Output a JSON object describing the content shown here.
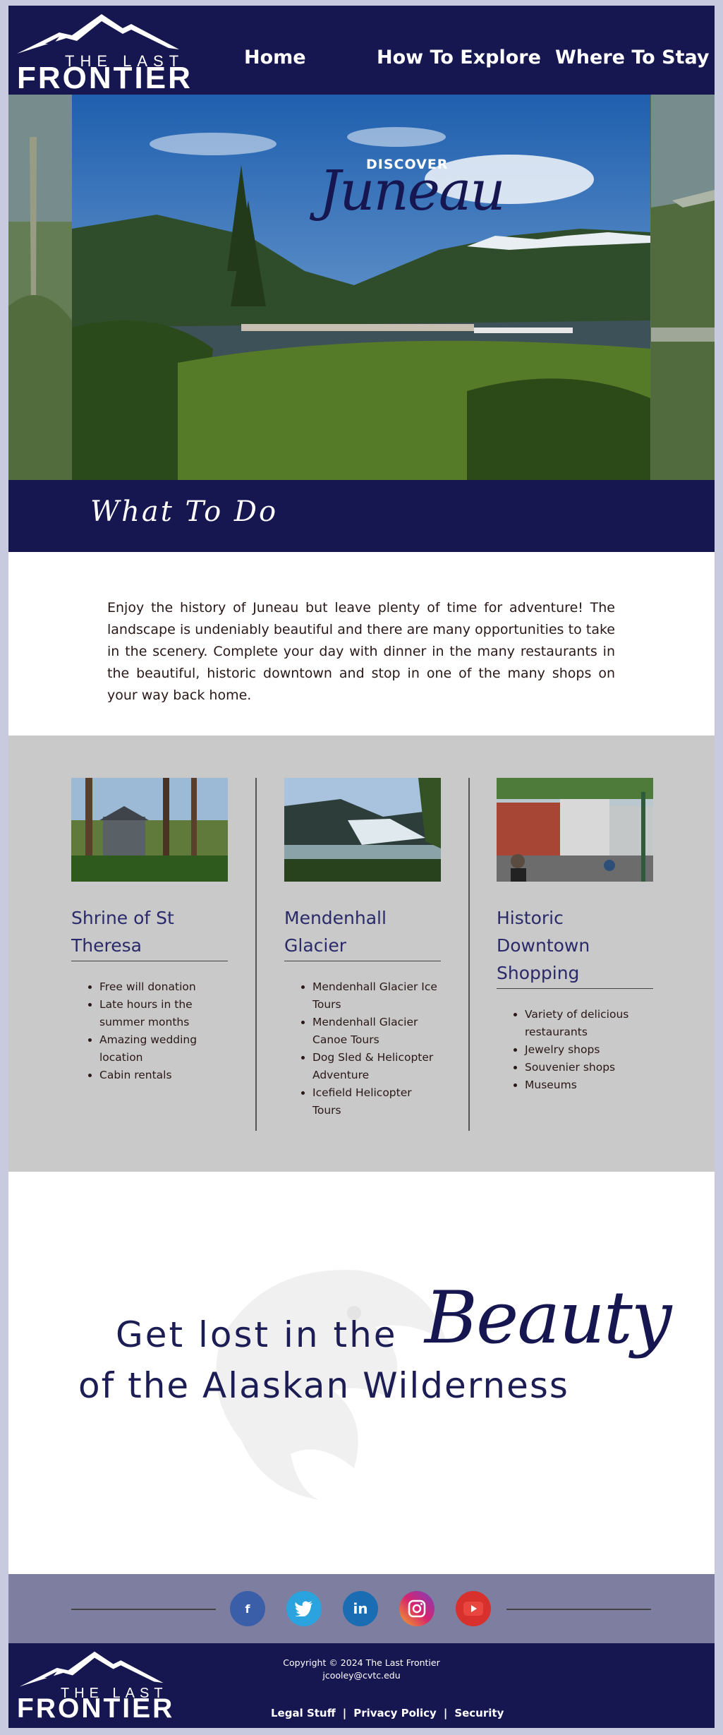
{
  "brand": {
    "logo_small": "THE LAST",
    "logo_big": "FRONTIER"
  },
  "nav": {
    "items": [
      {
        "label": "Home"
      },
      {
        "label": "How To Explore"
      },
      {
        "label": "Where To Stay"
      }
    ]
  },
  "hero": {
    "discover": "DISCOVER",
    "city": "Juneau"
  },
  "section": {
    "title": "What To Do"
  },
  "intro": "Enjoy the history of Juneau but leave plenty of time for adventure! The landscape is undeniably beautiful and there are many opportunities to take in the scenery. Complete your day with dinner in the many restaurants in the beautiful, historic downtown and stop in one of the many shops on your way back home.",
  "activities": [
    {
      "title": "Shrine of St Theresa",
      "items": [
        "Free will donation",
        "Late hours in the summer months",
        "Amazing wedding location",
        "Cabin rentals"
      ]
    },
    {
      "title": "Mendenhall Glacier",
      "items": [
        "Mendenhall Glacier Ice Tours",
        "Mendenhall Glacier Canoe Tours",
        "Dog Sled & Helicopter Adventure",
        "Icefield Helicopter Tours"
      ]
    },
    {
      "title": "Historic Downtown Shopping",
      "items": [
        "Variety of delicious restaurants",
        "Jewelry shops",
        "Souvenier shops",
        "Museums"
      ]
    }
  ],
  "tagline": {
    "line1": "Get lost in the",
    "accent": "Beauty",
    "line2": "of the Alaskan Wilderness"
  },
  "social": {
    "icons": [
      "facebook-icon",
      "twitter-icon",
      "linkedin-icon",
      "instagram-icon",
      "youtube-icon"
    ]
  },
  "footer": {
    "copyright": "Copyright © 2024 The Last Frontier",
    "email": "jcooley@cvtc.edu",
    "links": [
      "Legal Stuff",
      "Privacy Policy",
      "Security"
    ]
  },
  "colors": {
    "navy": "#161650",
    "gray_band": "#c9c9c9",
    "social_band": "#7e7fa0"
  }
}
